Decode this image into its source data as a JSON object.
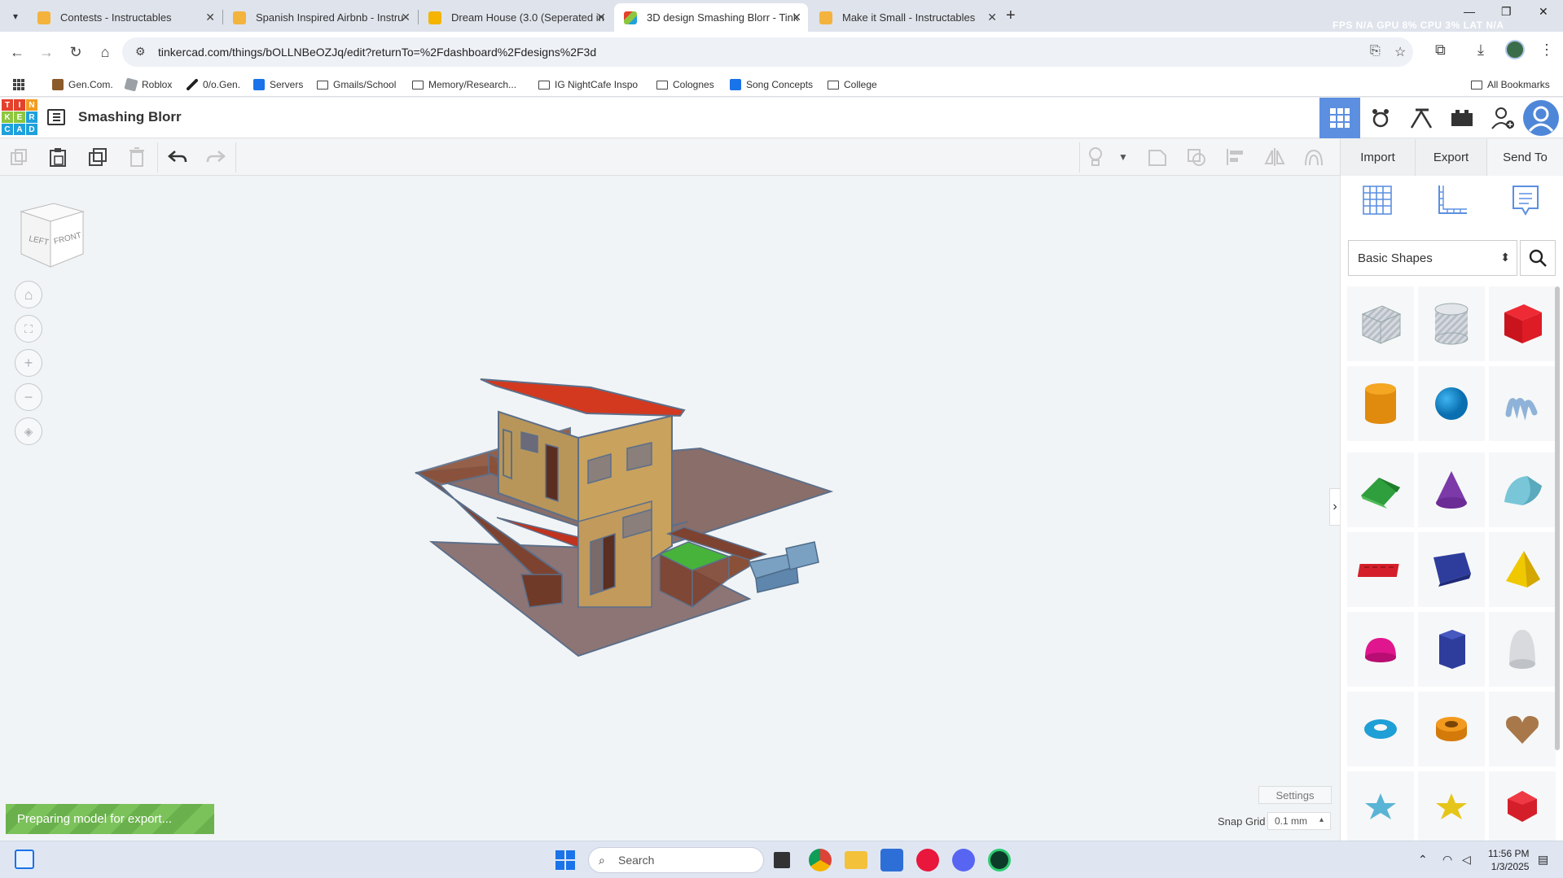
{
  "browser": {
    "tabs": [
      {
        "title": "Contests - Instructables",
        "favicon_color": "#f3b33d",
        "active": false
      },
      {
        "title": "Spanish Inspired Airbnb - Instru",
        "favicon_color": "#f3b33d",
        "active": false
      },
      {
        "title": "Dream House (3.0 (Seperated in",
        "favicon_color": "#f4b400",
        "active": false
      },
      {
        "title": "3D design Smashing Blorr - Tink",
        "favicon_color": "#e95b3d",
        "active": true
      },
      {
        "title": "Make it Small - Instructables",
        "favicon_color": "#f3b33d",
        "active": false
      }
    ],
    "perf_overlay": "FPS N/A GPU 8% CPU 3% LAT N/A",
    "url": "tinkercad.com/things/bOLLNBeOZJq/edit?returnTo=%2Fdashboard%2Fdesigns%2F3d",
    "bookmarks": [
      {
        "label": "Gen.Com.",
        "icon": "brown-square"
      },
      {
        "label": "Roblox",
        "icon": "roblox-icon"
      },
      {
        "label": "0/o.Gen.",
        "icon": "brush-icon"
      },
      {
        "label": "Servers",
        "icon": "blue-grid"
      },
      {
        "label": "Gmails/School",
        "icon": "folder"
      },
      {
        "label": "Memory/Research...",
        "icon": "folder"
      },
      {
        "label": "IG NightCafe Inspo",
        "icon": "folder"
      },
      {
        "label": "Colognes",
        "icon": "folder"
      },
      {
        "label": "Song Concepts",
        "icon": "doc"
      },
      {
        "label": "College",
        "icon": "folder"
      }
    ],
    "all_bookmarks": "All Bookmarks"
  },
  "tinkercad": {
    "logo_letters": [
      "T",
      "I",
      "N",
      "K",
      "E",
      "R",
      "C",
      "A",
      "D"
    ],
    "logo_colors": [
      "#e4412c",
      "#e4412c",
      "#f39c22",
      "#8dc63f",
      "#8dc63f",
      "#1ea1dc",
      "#1ea1dc",
      "#1ea1dc",
      "#1ea1dc"
    ],
    "design_name": "Smashing Blorr",
    "actions": {
      "import": "Import",
      "export": "Export",
      "send_to": "Send To"
    },
    "shape_category": "Basic Shapes",
    "export_status": "Preparing model for export...",
    "settings": "Settings",
    "snap_grid_label": "Snap Grid",
    "snap_grid_value": "0.1 mm",
    "viewcube": {
      "left": "LEFT",
      "front": "FRONT"
    },
    "shapes": [
      "box-hole-icon",
      "cylinder-hole-icon",
      "box-icon",
      "cylinder-icon",
      "sphere-icon",
      "scribble-icon",
      "roof-icon",
      "cone-icon",
      "round-roof-icon",
      "text-icon",
      "prism-icon",
      "pyramid-icon",
      "half-sphere-icon",
      "polygon-icon",
      "paraboloid-icon",
      "torus-icon",
      "tube-icon",
      "heart-icon",
      "star-icon",
      "star-gold-icon",
      "icosahedron-icon"
    ]
  },
  "taskbar": {
    "search_placeholder": "Search",
    "time": "11:56 PM",
    "date": "1/3/2025"
  }
}
